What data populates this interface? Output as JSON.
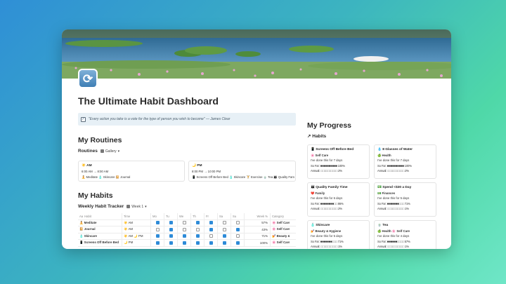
{
  "page": {
    "icon": "sync-icon",
    "title": "The Ultimate Habit Dashboard",
    "quote": "\"Every action you take is a vote for the type of person you wish to become\" — James Clear"
  },
  "routines": {
    "heading": "My Routines",
    "view_title": "Routines",
    "view_label": "Gallery",
    "cards": [
      {
        "name": "☀️ AM",
        "time": "6:00 AM → 8:00 AM",
        "items": "🧘 Meditate 🧴 Skincare 📔 Journal"
      },
      {
        "name": "🌙 PM",
        "time": "8:00 PM → 10:00 PM",
        "items": "📱 Screens Off Before Bed 🧴 Skincare 🏋️ Exercise 🍵 Tea 👪 Quality Fam"
      }
    ]
  },
  "habits": {
    "heading": "My Habits",
    "view_title": "Weekly Habit Tracker",
    "view_label": "Week 1",
    "columns": [
      "Habit",
      "Time",
      "Mo",
      "Tu",
      "We",
      "Th",
      "Fr",
      "Sa",
      "Su",
      "Week %",
      "Category"
    ],
    "rows": [
      {
        "habit": "🧘 Meditate",
        "time": "☀️ AM",
        "days": [
          true,
          true,
          false,
          true,
          true,
          false,
          false
        ],
        "week": "57%",
        "category": "🌸 Self Care"
      },
      {
        "habit": "📔 Journal",
        "time": "☀️ AM",
        "days": [
          false,
          true,
          false,
          false,
          true,
          false,
          true
        ],
        "week": "43%",
        "category": "🌸 Self Care"
      },
      {
        "habit": "🧴 Skincare",
        "time": "☀️ AM  🌙 PM",
        "days": [
          true,
          true,
          true,
          true,
          false,
          true,
          false
        ],
        "week": "71%",
        "category": "💅 Beauty & H"
      },
      {
        "habit": "📱 Screens Off Before Bed",
        "time": "🌙 PM",
        "days": [
          true,
          true,
          true,
          true,
          true,
          true,
          true
        ],
        "week": "100%",
        "category": "🌸 Self Care"
      }
    ]
  },
  "progress": {
    "heading": "My Progress",
    "view_title": "↗ Habits",
    "cards": [
      {
        "name": "📱 Screens Off Before Bed",
        "category": "🌸 Self Care",
        "done": "I've done this for 7 days",
        "sofar": "So Far: ■■■■■■■■■■ 100%",
        "annual": "Annual: □□□□□□□□□□ 2%"
      },
      {
        "name": "💧 8 Glasses of Water",
        "category": "🍏 Health",
        "done": "I've done this for 7 days",
        "sofar": "So Far: ■■■■■■■■■■ 100%",
        "annual": "Annual: □□□□□□□□□□ 2%"
      },
      {
        "name": "👪 Quality Family Time",
        "category": "❤️ Family",
        "done": "I've done this for 6 days",
        "sofar": "So Far: ■■■■■■■■□□ 86%",
        "annual": "Annual: □□□□□□□□□□ 2%"
      },
      {
        "name": "💵 Spend <$30 a Day",
        "category": "💵 Finances",
        "done": "I've done this for 5 days",
        "sofar": "So Far: ■■■■■■■□□□ 71%",
        "annual": "Annual: □□□□□□□□□□ 1%"
      },
      {
        "name": "🧴 Skincare",
        "category": "💅 Beauty & Hygiene",
        "done": "I've done this for 5 days",
        "sofar": "So Far: ■■■■■■■□□□ 71%",
        "annual": "Annual: □□□□□□□□□□ 1%"
      },
      {
        "name": "🍵 Tea",
        "category": "🍏 Health  🌸 Self Care",
        "done": "I've done this for 4 days",
        "sofar": "So Far: ■■■■■■□□□□ 57%",
        "annual": "Annual: □□□□□□□□□□ 1%"
      }
    ]
  }
}
